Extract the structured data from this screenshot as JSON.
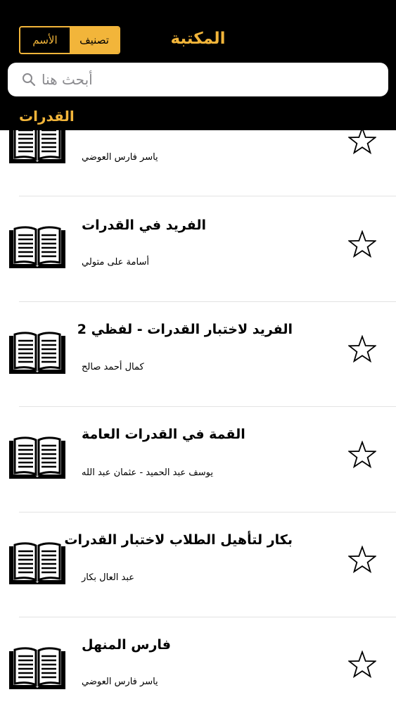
{
  "header": {
    "title": "المكتبة",
    "segments": {
      "by_name": "الأسم",
      "by_category": "تصنيف"
    },
    "selected_segment": "تصنيف",
    "accent_color": "#f2b53a"
  },
  "search": {
    "placeholder": "أبحث هنا",
    "icon": "search-icon"
  },
  "category": {
    "title": "القدرات"
  },
  "books": [
    {
      "title": "",
      "author": "ياسر فارس العوضي",
      "icon": "book-icon",
      "favorite": false
    },
    {
      "title": "الفريد في القدرات",
      "author": "أسامة على متولي",
      "icon": "book-icon",
      "favorite": false
    },
    {
      "title": "الفريد لاختبار القدرات - لفظي 2",
      "author": "كمال أحمد صالح",
      "icon": "book-icon",
      "favorite": false
    },
    {
      "title": "القمة في القدرات العامة",
      "author": "يوسف عبد الحميد - عثمان عبد الله",
      "icon": "book-icon",
      "favorite": false
    },
    {
      "title": "بكار لتأهيل الطلاب لاختبار القدرات",
      "author": "عبد العال بكار",
      "icon": "book-icon",
      "favorite": false
    },
    {
      "title": "فارس المنهل",
      "author": "ياسر فارس العوضي",
      "icon": "book-icon",
      "favorite": false
    }
  ]
}
